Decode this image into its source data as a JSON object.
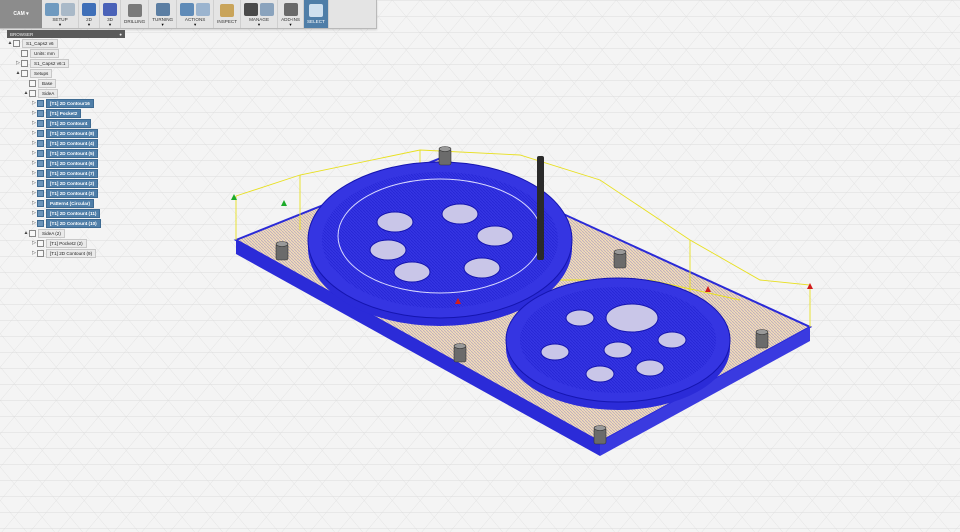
{
  "toolbar": {
    "workspace": "CAM",
    "groups": [
      {
        "label": "SETUP",
        "dropdown": true
      },
      {
        "label": "2D",
        "dropdown": true
      },
      {
        "label": "3D",
        "dropdown": true
      },
      {
        "label": "DRILLING",
        "dropdown": false
      },
      {
        "label": "TURNING",
        "dropdown": true
      },
      {
        "label": "ACTIONS",
        "dropdown": true
      },
      {
        "label": "INSPECT",
        "dropdown": false
      },
      {
        "label": "MANAGE",
        "dropdown": true
      },
      {
        "label": "ADD-INS",
        "dropdown": true
      },
      {
        "label": "SELECT",
        "dropdown": false
      }
    ]
  },
  "browser": {
    "title": "BROWSER",
    "nodes": [
      {
        "label": "S1_Caps2 v6",
        "indent": 0,
        "twisty": "▲",
        "type": "doc"
      },
      {
        "label": "Units: mm",
        "indent": 1,
        "twisty": "",
        "type": "plain"
      },
      {
        "label": "S1_Caps2 v6:1",
        "indent": 1,
        "twisty": "▷",
        "type": "plain"
      },
      {
        "label": "Setups",
        "indent": 1,
        "twisty": "▲",
        "type": "plain"
      },
      {
        "label": "Base",
        "indent": 2,
        "twisty": "",
        "type": "plain"
      },
      {
        "label": "SideA",
        "indent": 2,
        "twisty": "▲",
        "type": "setup"
      },
      {
        "label": "[T1] 2D Contour16",
        "indent": 3,
        "twisty": "▷",
        "type": "op"
      },
      {
        "label": "[T1] Pocket2",
        "indent": 3,
        "twisty": "▷",
        "type": "op"
      },
      {
        "label": "[T1] 2D Contour4",
        "indent": 3,
        "twisty": "▷",
        "type": "op"
      },
      {
        "label": "[T1] 2D Contour4 (8)",
        "indent": 3,
        "twisty": "▷",
        "type": "op"
      },
      {
        "label": "[T1] 2D Contour4 (4)",
        "indent": 3,
        "twisty": "▷",
        "type": "op"
      },
      {
        "label": "[T1] 2D Contour4 (5)",
        "indent": 3,
        "twisty": "▷",
        "type": "op"
      },
      {
        "label": "[T1] 2D Contour4 (6)",
        "indent": 3,
        "twisty": "▷",
        "type": "op"
      },
      {
        "label": "[T1] 2D Contour4 (7)",
        "indent": 3,
        "twisty": "▷",
        "type": "op"
      },
      {
        "label": "[T1] 2D Contour4 (2)",
        "indent": 3,
        "twisty": "▷",
        "type": "op"
      },
      {
        "label": "[T1] 2D Contour4 (3)",
        "indent": 3,
        "twisty": "▷",
        "type": "op"
      },
      {
        "label": "Pattern4 (Circular)",
        "indent": 3,
        "twisty": "▷",
        "type": "op"
      },
      {
        "label": "[T1] 2D Contour4 (11)",
        "indent": 3,
        "twisty": "▷",
        "type": "op"
      },
      {
        "label": "[T1] 2D Contour4 (10)",
        "indent": 3,
        "twisty": "▷",
        "type": "op"
      },
      {
        "label": "SideA (2)",
        "indent": 2,
        "twisty": "▲",
        "type": "plain"
      },
      {
        "label": "[T1] Pocket2 (2)",
        "indent": 3,
        "twisty": "▷",
        "type": "plain"
      },
      {
        "label": "[T1] 2D Contour4 (9)",
        "indent": 3,
        "twisty": "▷",
        "type": "plain"
      }
    ]
  },
  "colors": {
    "toolpath": "#2b2bd8",
    "stock": "#f2dcb8",
    "selection": "#4f7ea8",
    "tool": "#2a2a2a",
    "retract": "#e8e020"
  },
  "icons": [
    "setup-icon",
    "contour-2d-icon",
    "adaptive-3d-icon",
    "drilling-icon",
    "turning-icon",
    "actions-icon",
    "inspect-icon",
    "manage-icon",
    "addins-icon",
    "select-icon"
  ]
}
